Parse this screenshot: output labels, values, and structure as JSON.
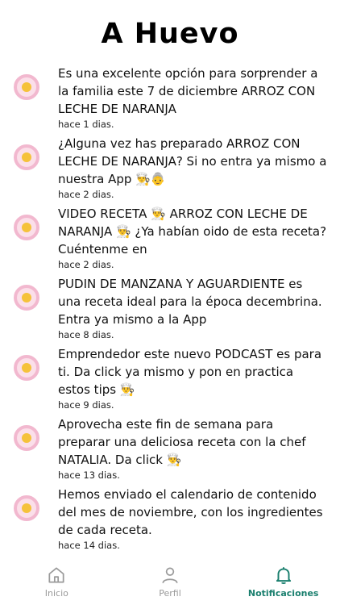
{
  "header": {
    "title": "A Huevo"
  },
  "notifications": [
    {
      "text": "Es una excelente opción para sorprender a la familia este 7 de diciembre ARROZ CON LECHE DE NARANJA",
      "time": "hace 1 dias."
    },
    {
      "text": "¿Alguna vez has preparado ARROZ CON LECHE DE NARANJA? Si no entra ya mismo a nuestra App 👨‍🍳👵",
      "time": "hace 2 dias."
    },
    {
      "text": "VIDEO  RECETA 👨‍🍳 ARROZ CON LECHE DE NARANJA 👨‍🍳 ¿Ya habían oido de esta receta? Cuéntenme en",
      "time": "hace 2 dias."
    },
    {
      "text": "PUDIN DE MANZANA Y AGUARDIENTE es una receta ideal para la época decembrina. Entra ya mismo a la App",
      "time": "hace 8 dias."
    },
    {
      "text": "Emprendedor este nuevo PODCAST es para ti. Da click ya mismo y pon en practica estos tips 👨‍🍳",
      "time": "hace 9 dias."
    },
    {
      "text": "Aprovecha este fin de semana para preparar una deliciosa receta con la chef NATALIA. Da click 👨‍🍳",
      "time": "hace 13 dias."
    },
    {
      "text": "Hemos enviado el calendario de contenido del mes de noviembre, con los ingredientes de cada receta.",
      "time": "hace 14 dias."
    }
  ],
  "tabs": [
    {
      "label": "Inicio",
      "icon": "home-icon"
    },
    {
      "label": "Perfil",
      "icon": "person-icon"
    },
    {
      "label": "Notificaciones",
      "icon": "bell-icon",
      "active": true
    }
  ],
  "colors": {
    "accent": "#1a7f6e",
    "inactive": "#9a9a9a",
    "egg_white": "#fbdfe9",
    "egg_ring": "#f2b8cf",
    "egg_yolk": "#f5c23a"
  }
}
